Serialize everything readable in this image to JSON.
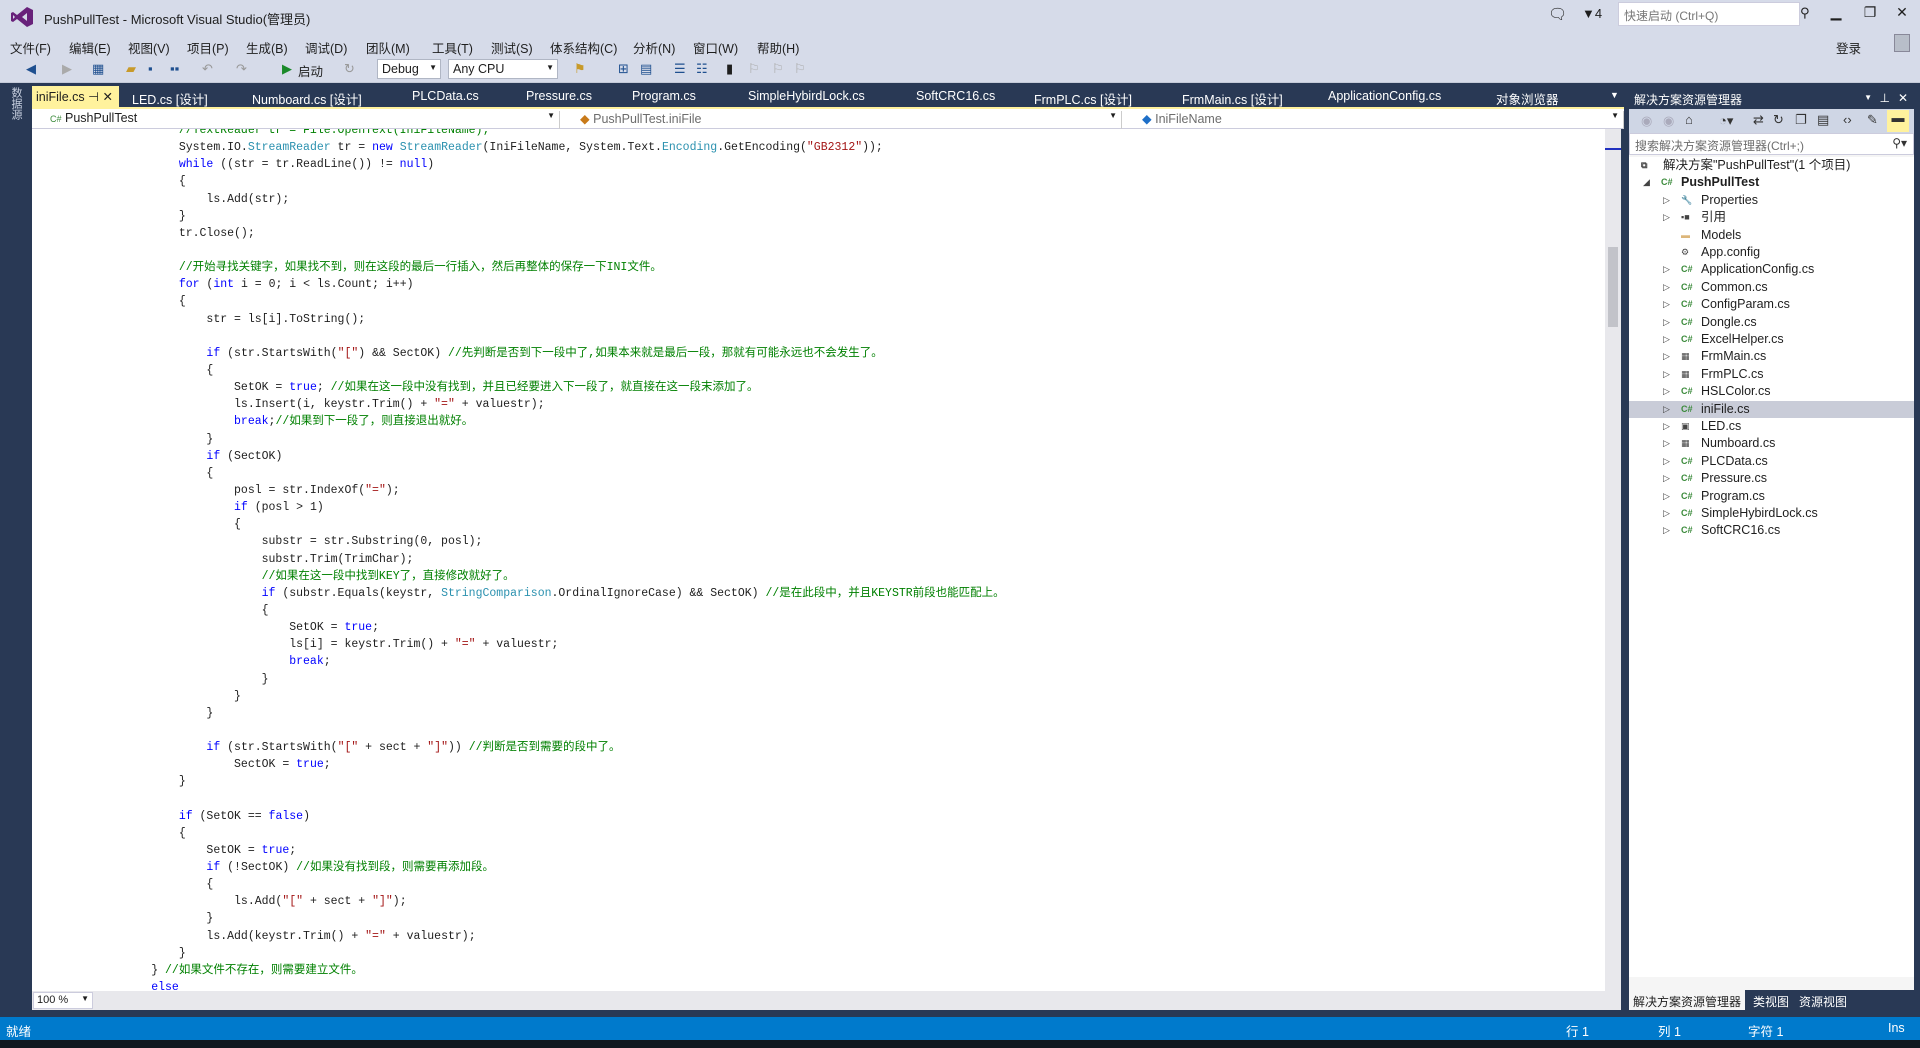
{
  "window": {
    "title": "PushPullTest - Microsoft Visual Studio(管理员)",
    "notif_count": "4",
    "quick_launch_placeholder": "快速启动 (Ctrl+Q)",
    "login": "登录"
  },
  "menu": [
    "文件(F)",
    "编辑(E)",
    "视图(V)",
    "项目(P)",
    "生成(B)",
    "调试(D)",
    "团队(M)",
    "工具(T)",
    "测试(S)",
    "体系结构(C)",
    "分析(N)",
    "窗口(W)",
    "帮助(H)"
  ],
  "toolbar": {
    "start_label": "启动",
    "config": "Debug",
    "platform": "Any CPU"
  },
  "left_strip": "数据源",
  "tabs": [
    "iniFile.cs",
    "LED.cs [设计]",
    "Numboard.cs [设计]",
    "PLCData.cs",
    "Pressure.cs",
    "Program.cs",
    "SimpleHybirdLock.cs",
    "SoftCRC16.cs",
    "FrmPLC.cs [设计]",
    "FrmMain.cs [设计]",
    "ApplicationConfig.cs",
    "对象浏览器"
  ],
  "navbar": {
    "project": "PushPullTest",
    "type": "PushPullTest.iniFile",
    "member": "IniFileName"
  },
  "code": [
    [
      [
        "c",
        "            //TextReader tr = File.OpenText(IniFileName);"
      ]
    ],
    [
      [
        "p",
        "            System.IO."
      ],
      [
        "t",
        "StreamReader"
      ],
      [
        "p",
        " tr = "
      ],
      [
        "k",
        "new"
      ],
      [
        "p",
        " "
      ],
      [
        "t",
        "StreamReader"
      ],
      [
        "p",
        "(IniFileName, System.Text."
      ],
      [
        "t",
        "Encoding"
      ],
      [
        "p",
        ".GetEncoding("
      ],
      [
        "s",
        "\"GB2312\""
      ],
      [
        "p",
        "));"
      ]
    ],
    [
      [
        "k",
        "            while"
      ],
      [
        "p",
        " ((str = tr.ReadLine()) != "
      ],
      [
        "k",
        "null"
      ],
      [
        "p",
        ")"
      ]
    ],
    [
      [
        "p",
        "            {"
      ]
    ],
    [
      [
        "p",
        "                ls.Add(str);"
      ]
    ],
    [
      [
        "p",
        "            }"
      ]
    ],
    [
      [
        "p",
        "            tr.Close();"
      ]
    ],
    [
      [
        "p",
        ""
      ]
    ],
    [
      [
        "c",
        "            //开始寻找关键字，如果找不到，则在这段的最后一行插入，然后再整体的保存一下INI文件。"
      ]
    ],
    [
      [
        "k",
        "            for"
      ],
      [
        "p",
        " ("
      ],
      [
        "k",
        "int"
      ],
      [
        "p",
        " i = 0; i < ls.Count; i++)"
      ]
    ],
    [
      [
        "p",
        "            {"
      ]
    ],
    [
      [
        "p",
        "                str = ls[i].ToString();"
      ]
    ],
    [
      [
        "p",
        ""
      ]
    ],
    [
      [
        "k",
        "                if"
      ],
      [
        "p",
        " (str.StartsWith("
      ],
      [
        "s",
        "\"[\""
      ],
      [
        "p",
        ") && SectOK) "
      ],
      [
        "c",
        "//先判断是否到下一段中了,如果本来就是最后一段，那就有可能永远也不会发生了。"
      ]
    ],
    [
      [
        "p",
        "                {"
      ]
    ],
    [
      [
        "p",
        "                    SetOK = "
      ],
      [
        "k",
        "true"
      ],
      [
        "p",
        "; "
      ],
      [
        "c",
        "//如果在这一段中没有找到，并且已经要进入下一段了，就直接在这一段末添加了。"
      ]
    ],
    [
      [
        "p",
        "                    ls.Insert(i, keystr.Trim() + "
      ],
      [
        "s",
        "\"=\""
      ],
      [
        "p",
        " + valuestr);"
      ]
    ],
    [
      [
        "k",
        "                    break"
      ],
      [
        "p",
        ";"
      ],
      [
        "c",
        "//如果到下一段了，则直接退出就好。"
      ]
    ],
    [
      [
        "p",
        "                }"
      ]
    ],
    [
      [
        "k",
        "                if"
      ],
      [
        "p",
        " (SectOK)"
      ]
    ],
    [
      [
        "p",
        "                {"
      ]
    ],
    [
      [
        "p",
        "                    posl = str.IndexOf("
      ],
      [
        "s",
        "\"=\""
      ],
      [
        "p",
        ");"
      ]
    ],
    [
      [
        "k",
        "                    if"
      ],
      [
        "p",
        " (posl > 1)"
      ]
    ],
    [
      [
        "p",
        "                    {"
      ]
    ],
    [
      [
        "p",
        "                        substr = str.Substring(0, posl);"
      ]
    ],
    [
      [
        "p",
        "                        substr.Trim(TrimChar);"
      ]
    ],
    [
      [
        "c",
        "                        //如果在这一段中找到KEY了，直接修改就好了。"
      ]
    ],
    [
      [
        "k",
        "                        if"
      ],
      [
        "p",
        " (substr.Equals(keystr, "
      ],
      [
        "t",
        "StringComparison"
      ],
      [
        "p",
        ".OrdinalIgnoreCase) && SectOK) "
      ],
      [
        "c",
        "//是在此段中，并且KEYSTR前段也能匹配上。"
      ]
    ],
    [
      [
        "p",
        "                        {"
      ]
    ],
    [
      [
        "p",
        "                            SetOK = "
      ],
      [
        "k",
        "true"
      ],
      [
        "p",
        ";"
      ]
    ],
    [
      [
        "p",
        "                            ls[i] = keystr.Trim() + "
      ],
      [
        "s",
        "\"=\""
      ],
      [
        "p",
        " + valuestr;"
      ]
    ],
    [
      [
        "k",
        "                            break"
      ],
      [
        "p",
        ";"
      ]
    ],
    [
      [
        "p",
        "                        }"
      ]
    ],
    [
      [
        "p",
        "                    }"
      ]
    ],
    [
      [
        "p",
        "                }"
      ]
    ],
    [
      [
        "p",
        ""
      ]
    ],
    [
      [
        "k",
        "                if"
      ],
      [
        "p",
        " (str.StartsWith("
      ],
      [
        "s",
        "\"[\""
      ],
      [
        "p",
        " + sect + "
      ],
      [
        "s",
        "\"]\""
      ],
      [
        "p",
        ")) "
      ],
      [
        "c",
        "//判断是否到需要的段中了。"
      ]
    ],
    [
      [
        "p",
        "                    SectOK = "
      ],
      [
        "k",
        "true"
      ],
      [
        "p",
        ";"
      ]
    ],
    [
      [
        "p",
        "            }"
      ]
    ],
    [
      [
        "p",
        ""
      ]
    ],
    [
      [
        "k",
        "            if"
      ],
      [
        "p",
        " (SetOK == "
      ],
      [
        "k",
        "false"
      ],
      [
        "p",
        ")"
      ]
    ],
    [
      [
        "p",
        "            {"
      ]
    ],
    [
      [
        "p",
        "                SetOK = "
      ],
      [
        "k",
        "true"
      ],
      [
        "p",
        ";"
      ]
    ],
    [
      [
        "k",
        "                if"
      ],
      [
        "p",
        " (!SectOK) "
      ],
      [
        "c",
        "//如果没有找到段，则需要再添加段。"
      ]
    ],
    [
      [
        "p",
        "                {"
      ]
    ],
    [
      [
        "p",
        "                    ls.Add("
      ],
      [
        "s",
        "\"[\""
      ],
      [
        "p",
        " + sect + "
      ],
      [
        "s",
        "\"]\""
      ],
      [
        "p",
        ");"
      ]
    ],
    [
      [
        "p",
        "                }"
      ]
    ],
    [
      [
        "p",
        "                ls.Add(keystr.Trim() + "
      ],
      [
        "s",
        "\"=\""
      ],
      [
        "p",
        " + valuestr);"
      ]
    ],
    [
      [
        "p",
        "            }"
      ]
    ],
    [
      [
        "p",
        "        } "
      ],
      [
        "c",
        "//如果文件不存在，则需要建立文件。"
      ]
    ],
    [
      [
        "k",
        "        else"
      ]
    ]
  ],
  "editor": {
    "zoom": "100 %"
  },
  "solution_explorer": {
    "title": "解决方案资源管理器",
    "search_placeholder": "搜索解决方案资源管理器(Ctrl+;)",
    "items": [
      {
        "label": "解决方案\"PushPullTest\"(1 个项目)",
        "level": 0,
        "icon": "solution-icon",
        "expander": ""
      },
      {
        "label": "PushPullTest",
        "level": 1,
        "icon": "csharp-project-icon",
        "expander": "◢",
        "bold": true
      },
      {
        "label": "Properties",
        "level": 2,
        "icon": "wrench-icon",
        "expander": "▷"
      },
      {
        "label": "引用",
        "level": 2,
        "icon": "references-icon",
        "expander": "▷"
      },
      {
        "label": "Models",
        "level": 2,
        "icon": "folder-icon",
        "expander": ""
      },
      {
        "label": "App.config",
        "level": 2,
        "icon": "config-icon",
        "expander": ""
      },
      {
        "label": "ApplicationConfig.cs",
        "level": 2,
        "icon": "csharp-file-icon",
        "expander": "▷"
      },
      {
        "label": "Common.cs",
        "level": 2,
        "icon": "csharp-file-icon",
        "expander": "▷"
      },
      {
        "label": "ConfigParam.cs",
        "level": 2,
        "icon": "csharp-file-icon",
        "expander": "▷"
      },
      {
        "label": "Dongle.cs",
        "level": 2,
        "icon": "csharp-file-icon",
        "expander": "▷"
      },
      {
        "label": "ExcelHelper.cs",
        "level": 2,
        "icon": "csharp-file-icon",
        "expander": "▷"
      },
      {
        "label": "FrmMain.cs",
        "level": 2,
        "icon": "form-icon",
        "expander": "▷"
      },
      {
        "label": "FrmPLC.cs",
        "level": 2,
        "icon": "form-icon",
        "expander": "▷"
      },
      {
        "label": "HSLColor.cs",
        "level": 2,
        "icon": "csharp-file-icon",
        "expander": "▷"
      },
      {
        "label": "iniFile.cs",
        "level": 2,
        "icon": "csharp-file-icon",
        "expander": "▷",
        "selected": true
      },
      {
        "label": "LED.cs",
        "level": 2,
        "icon": "usercontrol-icon",
        "expander": "▷"
      },
      {
        "label": "Numboard.cs",
        "level": 2,
        "icon": "form-icon",
        "expander": "▷"
      },
      {
        "label": "PLCData.cs",
        "level": 2,
        "icon": "csharp-file-icon",
        "expander": "▷"
      },
      {
        "label": "Pressure.cs",
        "level": 2,
        "icon": "csharp-file-icon",
        "expander": "▷"
      },
      {
        "label": "Program.cs",
        "level": 2,
        "icon": "csharp-file-icon",
        "expander": "▷"
      },
      {
        "label": "SimpleHybirdLock.cs",
        "level": 2,
        "icon": "csharp-file-icon",
        "expander": "▷"
      },
      {
        "label": "SoftCRC16.cs",
        "level": 2,
        "icon": "csharp-file-icon",
        "expander": "▷"
      }
    ],
    "tabs": [
      "解决方案资源管理器",
      "类视图",
      "资源视图"
    ]
  },
  "status": {
    "ready": "就绪",
    "line": "行 1",
    "col": "列 1",
    "char": "字符 1",
    "mode": "Ins"
  }
}
